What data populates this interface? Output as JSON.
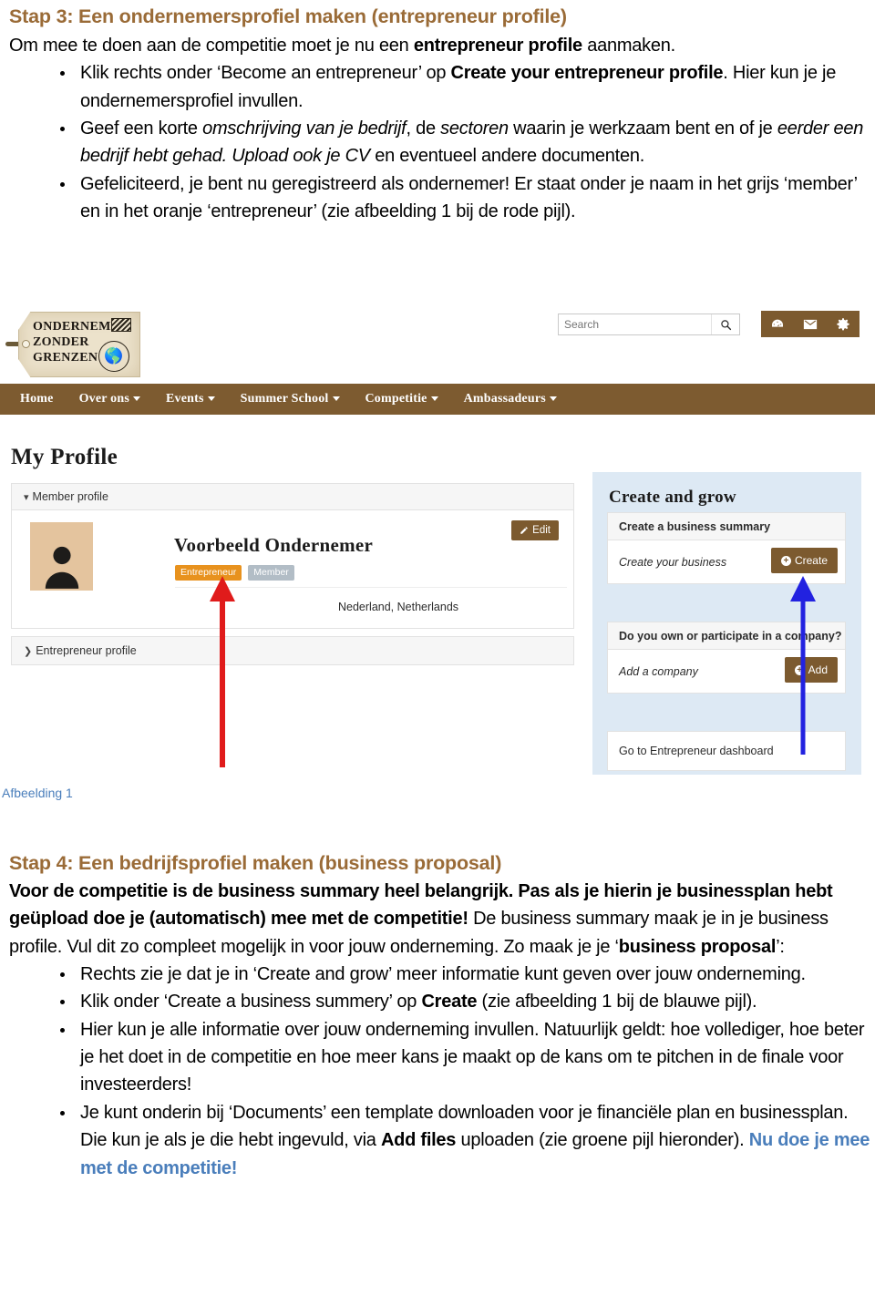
{
  "doc": {
    "step3": {
      "heading": "Stap 3: Een ondernemersprofiel maken (entrepreneur profile)",
      "intro_a": "Om mee te doen aan de competitie moet je nu een ",
      "intro_b": "entrepreneur profile",
      "intro_c": " aanmaken.",
      "bullets": [
        {
          "parts": [
            {
              "t": "Klik rechts onder ‘Become an entrepreneur’ op ",
              "s": "n"
            },
            {
              "t": "Create your entrepreneur profile",
              "s": "b"
            },
            {
              "t": ". Hier kun je je ondernemersprofiel invullen.",
              "s": "n"
            }
          ]
        },
        {
          "parts": [
            {
              "t": "Geef een korte ",
              "s": "n"
            },
            {
              "t": "omschrijving van je bedrijf",
              "s": "i"
            },
            {
              "t": ", de ",
              "s": "n"
            },
            {
              "t": "sectoren",
              "s": "i"
            },
            {
              "t": " waarin je werkzaam bent en of je ",
              "s": "n"
            },
            {
              "t": "eerder een bedrijf hebt gehad. Upload ook je CV",
              "s": "i"
            },
            {
              "t": " en eventueel andere documenten.",
              "s": "n"
            }
          ]
        },
        {
          "parts": [
            {
              "t": "Gefeliciteerd, je bent nu geregistreerd als ondernemer! Er staat onder je naam in het grijs ‘member’ en in het oranje ‘entrepreneur’ (zie afbeelding 1 bij de rode pijl).",
              "s": "n"
            }
          ]
        }
      ]
    },
    "figure_caption": "Afbeelding 1",
    "step4": {
      "heading": "Stap 4: Een bedrijfsprofiel maken (business proposal)",
      "intro_parts": [
        {
          "t": "Voor de competitie is de business summary heel belangrijk. Pas als je hierin je businessplan hebt geüpload doe je (automatisch) mee met de competitie!",
          "s": "b"
        },
        {
          "t": " De business summary maak je in je business profile. Vul dit zo compleet mogelijk in voor jouw onderneming. Zo maak je je ‘",
          "s": "n"
        },
        {
          "t": "business proposal",
          "s": "b"
        },
        {
          "t": "’:",
          "s": "n"
        }
      ],
      "bullets": [
        {
          "parts": [
            {
              "t": "Rechts zie je dat je in ‘Create and grow’ meer informatie kunt geven over jouw onderneming.",
              "s": "n"
            }
          ]
        },
        {
          "parts": [
            {
              "t": "Klik onder ‘Create a business summery’ op ",
              "s": "n"
            },
            {
              "t": "Create",
              "s": "b"
            },
            {
              "t": " (zie afbeelding 1 bij de blauwe pijl).",
              "s": "n"
            }
          ]
        },
        {
          "parts": [
            {
              "t": "Hier kun je alle informatie over jouw onderneming invullen. Natuurlijk geldt: hoe vollediger, hoe beter je het doet in de competitie en hoe meer kans je maakt op de kans om te pitchen in de finale voor investeerders!",
              "s": "n"
            }
          ]
        },
        {
          "parts": [
            {
              "t": "Je kunt onderin bij ‘Documents’ een template downloaden voor je financiële plan en businessplan. Die kun je als je die hebt ingevuld, via ",
              "s": "n"
            },
            {
              "t": "Add files",
              "s": "b"
            },
            {
              "t": " uploaden (zie groene pijl hieronder). ",
              "s": "n"
            },
            {
              "t": "Nu doe je mee met de competitie!",
              "s": "blue"
            }
          ]
        }
      ]
    }
  },
  "screenshot": {
    "logo": {
      "line1": "ONDERNEMEN",
      "line2": "ZONDER",
      "line3": "GRENZEN"
    },
    "search": {
      "placeholder": "Search",
      "value": ""
    },
    "header_icons": [
      {
        "name": "dashboard-icon",
        "label": "Dashboard"
      },
      {
        "name": "envelope-icon",
        "label": "Messages"
      },
      {
        "name": "gear-icon",
        "label": "Settings"
      }
    ],
    "nav": [
      {
        "label": "Home",
        "dropdown": false
      },
      {
        "label": "Over ons",
        "dropdown": true
      },
      {
        "label": "Events",
        "dropdown": true
      },
      {
        "label": "Summer School",
        "dropdown": true
      },
      {
        "label": "Competitie",
        "dropdown": true
      },
      {
        "label": "Ambassadeurs",
        "dropdown": true
      }
    ],
    "page_title": "My Profile",
    "member_card": {
      "header": "Member profile",
      "name": "Voorbeeld Ondernemer",
      "badge_entrepreneur": "Entrepreneur",
      "badge_member": "Member",
      "location": "Nederland, Netherlands",
      "edit_label": "Edit"
    },
    "entrepreneur_card": {
      "header": "Entrepreneur profile"
    },
    "create_and_grow": {
      "title": "Create and grow",
      "sections": [
        {
          "header": "Create a business summary",
          "body": "Create your business",
          "button": "Create",
          "has_button": true
        },
        {
          "header": "Do you own or participate in a company?",
          "body": "Add a company",
          "button": "Add",
          "has_button": true
        }
      ],
      "dashboard_link": "Go to Entrepreneur dashboard"
    },
    "annotations": [
      {
        "name": "red-arrow",
        "color": "#e01b1b",
        "points_to": "Entrepreneur badge"
      },
      {
        "name": "blue-arrow",
        "color": "#2222e0",
        "points_to": "Create button"
      }
    ]
  },
  "colors": {
    "heading_brown": "#9a6b37",
    "nav_brown": "#7d5b30",
    "badge_orange": "#e8921e",
    "badge_gray": "#b2bdc6",
    "panel_blue": "#dde9f4",
    "link_blue": "#4a7ebb",
    "red_arrow": "#e01b1b",
    "blue_arrow": "#2222e0"
  }
}
